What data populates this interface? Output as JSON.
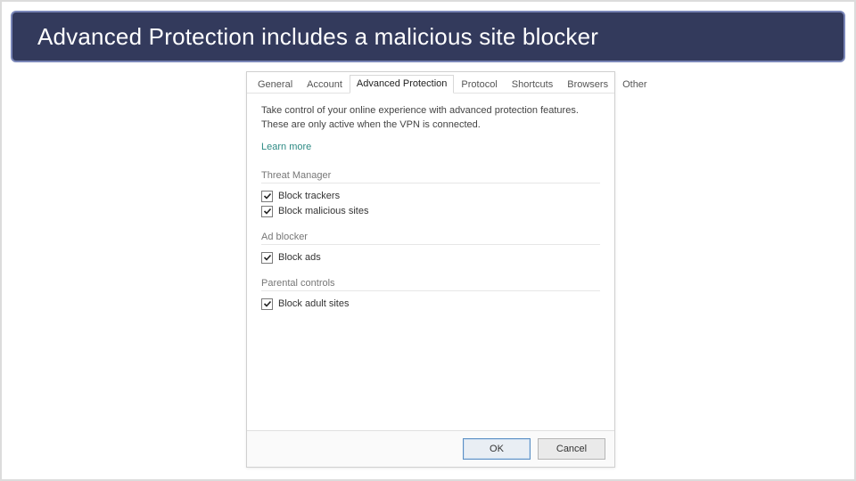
{
  "banner": {
    "text": "Advanced Protection includes a malicious site blocker"
  },
  "dialog": {
    "tabs": [
      "General",
      "Account",
      "Advanced Protection",
      "Protocol",
      "Shortcuts",
      "Browsers",
      "Other"
    ],
    "active_tab_index": 2,
    "description": "Take control of your online experience with advanced protection features. These are only active when the VPN is connected.",
    "learn_more": "Learn more",
    "sections": {
      "threat_manager": {
        "label": "Threat Manager",
        "options": {
          "block_trackers": {
            "label": "Block trackers",
            "checked": true
          },
          "block_malicious_sites": {
            "label": "Block malicious sites",
            "checked": true
          }
        }
      },
      "ad_blocker": {
        "label": "Ad blocker",
        "options": {
          "block_ads": {
            "label": "Block ads",
            "checked": true
          }
        }
      },
      "parental_controls": {
        "label": "Parental controls",
        "options": {
          "block_adult_sites": {
            "label": "Block adult sites",
            "checked": true
          }
        }
      }
    },
    "buttons": {
      "ok": "OK",
      "cancel": "Cancel"
    }
  }
}
